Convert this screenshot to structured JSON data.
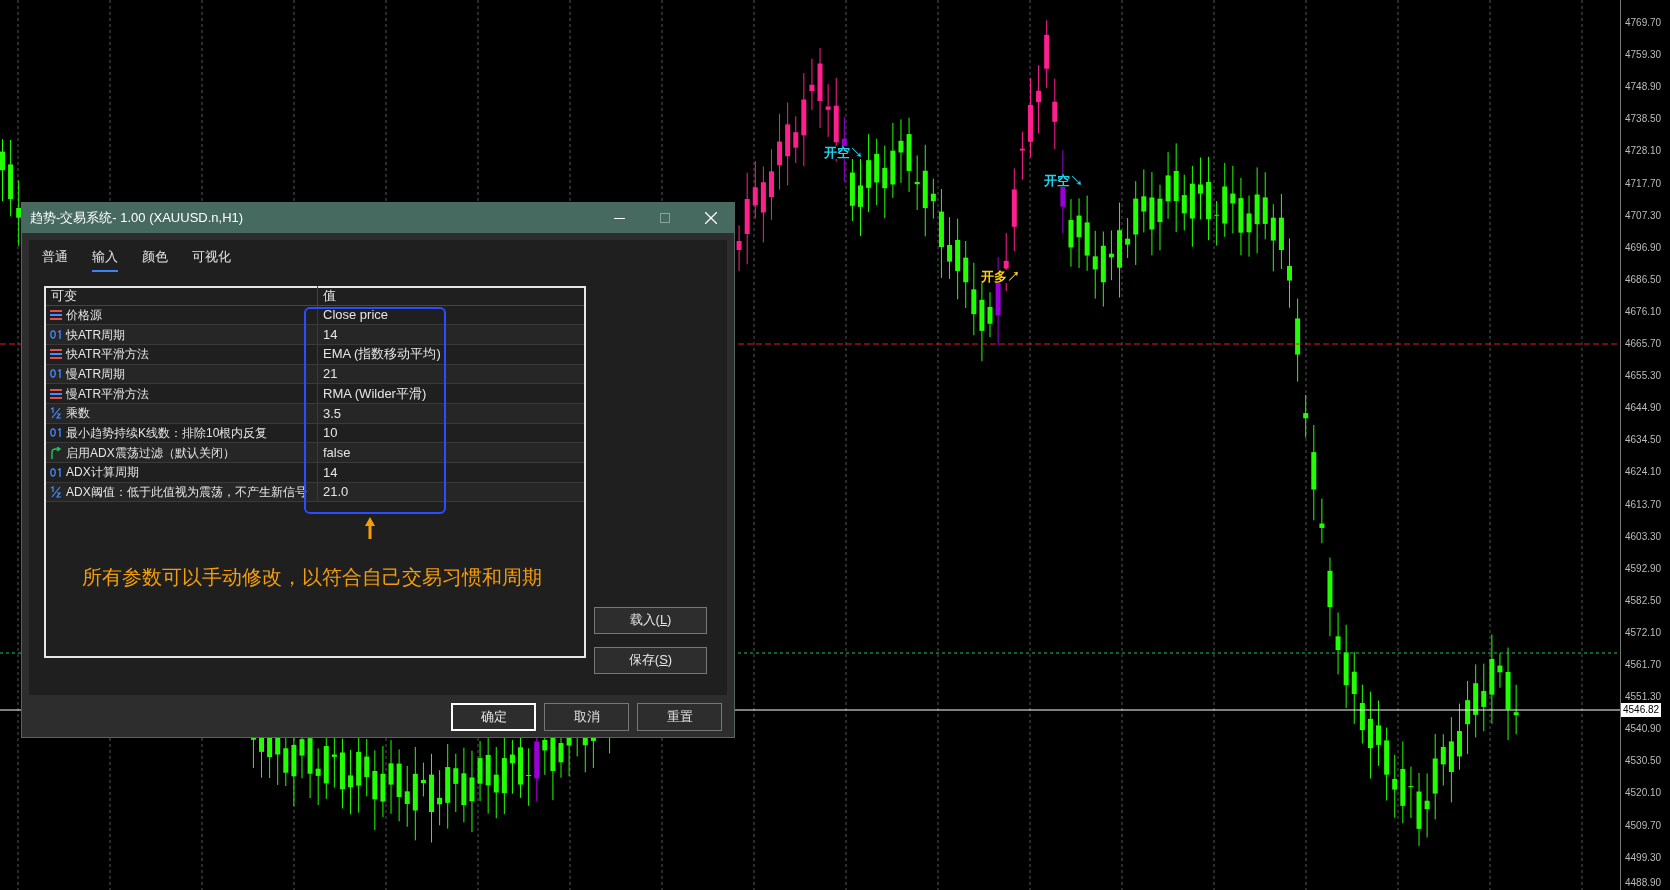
{
  "chart": {
    "price_axis": [
      "4769.70",
      "4759.30",
      "4748.90",
      "4738.50",
      "4728.10",
      "4717.70",
      "4707.30",
      "4696.90",
      "4686.50",
      "4676.10",
      "4665.70",
      "4655.30",
      "4644.90",
      "4634.50",
      "4624.10",
      "4613.70",
      "4603.30",
      "4592.90",
      "4582.50",
      "4572.10",
      "4561.70",
      "4551.30",
      "4540.90",
      "4530.50",
      "4520.10",
      "4509.70",
      "4499.30",
      "4488.90"
    ],
    "current_price": "4546.82",
    "signals": [
      {
        "text": "开空↘",
        "color": "#22d3ee"
      },
      {
        "text": "开空↘",
        "color": "#22d3ee"
      },
      {
        "text": "开多↗",
        "color": "#facc15"
      }
    ]
  },
  "dialog": {
    "title": "趋势-交易系统- 1.00 (XAUUSD.n,H1)",
    "tabs": [
      {
        "label": "普通",
        "selected": false
      },
      {
        "label": "输入",
        "selected": true
      },
      {
        "label": "颜色",
        "selected": false
      },
      {
        "label": "可视化",
        "selected": false
      }
    ],
    "table": {
      "columns": [
        "可变",
        "值"
      ],
      "rows": [
        {
          "kind": "enum",
          "name": "价格源",
          "value": "Close price"
        },
        {
          "kind": "int",
          "name": "快ATR周期",
          "value": "14"
        },
        {
          "kind": "enum",
          "name": "快ATR平滑方法",
          "value": "EMA (指数移动平均)"
        },
        {
          "kind": "int",
          "name": "慢ATR周期",
          "value": "21"
        },
        {
          "kind": "enum",
          "name": "慢ATR平滑方法",
          "value": "RMA (Wilder平滑)"
        },
        {
          "kind": "double",
          "name": "乘数",
          "value": "3.5"
        },
        {
          "kind": "int",
          "name": "最小趋势持续K线数：排除10根内反复",
          "value": "10"
        },
        {
          "kind": "bool",
          "name": "启用ADX震荡过滤（默认关闭）",
          "value": "false"
        },
        {
          "kind": "int",
          "name": "ADX计算周期",
          "value": "14"
        },
        {
          "kind": "double",
          "name": "ADX阈值：低于此值视为震荡，不产生新信号",
          "value": "21.0"
        }
      ]
    },
    "annotation": "所有参数可以手动修改，以符合自己交易习惯和周期",
    "side_buttons": [
      {
        "before": "载入(",
        "mnemonic": "L",
        "after": ")"
      },
      {
        "before": "保存(",
        "mnemonic": "S",
        "after": ")"
      }
    ],
    "bottom_buttons": [
      {
        "label": "确定",
        "default": true
      },
      {
        "label": "取消",
        "default": false
      },
      {
        "label": "重置",
        "default": false
      }
    ]
  }
}
